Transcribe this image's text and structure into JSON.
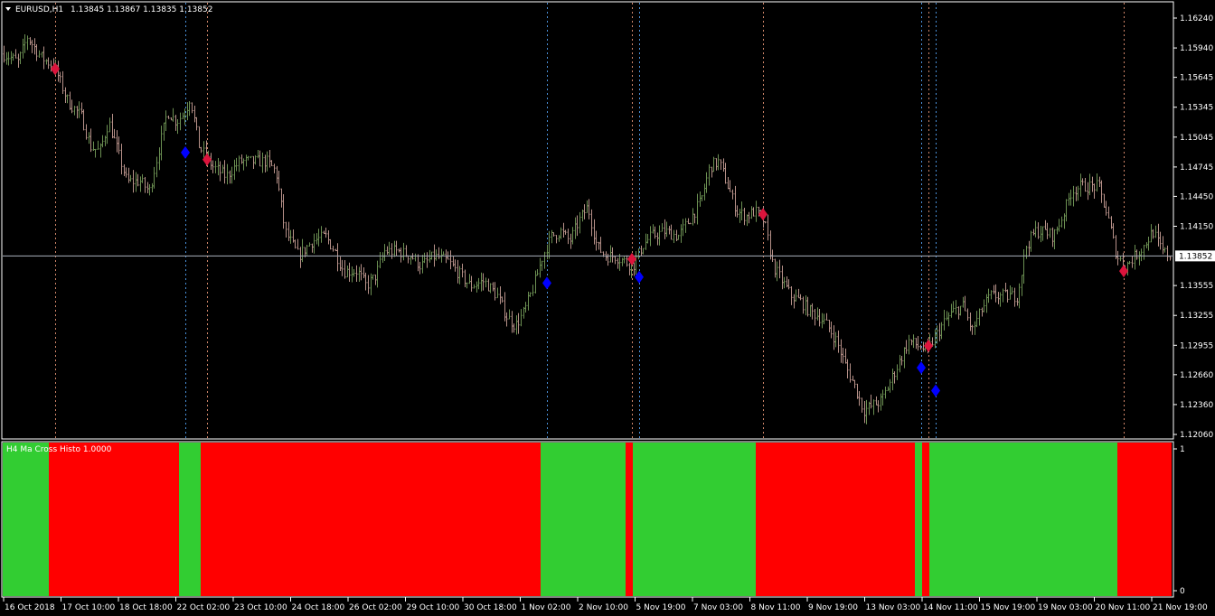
{
  "header": {
    "symbol_tf": "EURUSD,H1",
    "ohlc": "1.13845 1.13867 1.13835 1.13852"
  },
  "indicator": {
    "title": "H4 Ma Cross Histo 1.0000",
    "axis_ticks": [
      "1",
      "0"
    ]
  },
  "colors": {
    "background": "#000000",
    "bull_bar": "#6b8f52",
    "bear_bar": "#b79189",
    "axis": "#ffffff",
    "sell_marker": "#dc143c",
    "buy_marker": "#0000ff",
    "sell_vline": "#d2876a",
    "buy_vline": "#4a90d9",
    "histo_green": "#32cd32",
    "histo_red": "#ff0000",
    "price_line": "#a9b1bd"
  },
  "icons": {
    "dropdown": "triangle-down-icon",
    "sell_signal": "red-diamond-icon",
    "buy_signal": "blue-diamond-icon"
  },
  "chart_data": {
    "type": "ohlc",
    "price_axis": {
      "ticks": [
        "1.16240",
        "1.15940",
        "1.15645",
        "1.15345",
        "1.15045",
        "1.14745",
        "1.14450",
        "1.14150",
        "1.13555",
        "1.13255",
        "1.12955",
        "1.12660",
        "1.12360",
        "1.12060"
      ],
      "ylim": [
        1.1206,
        1.1624
      ],
      "current_price": "1.13852"
    },
    "time_axis": {
      "ticks": [
        "16 Oct 2018",
        "17 Oct 10:00",
        "18 Oct 18:00",
        "22 Oct 02:00",
        "23 Oct 10:00",
        "24 Oct 18:00",
        "26 Oct 02:00",
        "29 Oct 10:00",
        "30 Oct 18:00",
        "1 Nov 02:00",
        "2 Nov 10:00",
        "5 Nov 19:00",
        "7 Nov 03:00",
        "8 Nov 11:00",
        "9 Nov 19:00",
        "13 Nov 03:00",
        "14 Nov 11:00",
        "15 Nov 19:00",
        "19 Nov 03:00",
        "20 Nov 11:00",
        "21 Nov 19:00"
      ]
    },
    "close_path": [
      [
        0,
        1.159
      ],
      [
        20,
        1.158
      ],
      [
        30,
        1.1605
      ],
      [
        45,
        1.1585
      ],
      [
        60,
        1.1575
      ],
      [
        75,
        1.154
      ],
      [
        90,
        1.1525
      ],
      [
        100,
        1.1495
      ],
      [
        110,
        1.149
      ],
      [
        120,
        1.152
      ],
      [
        130,
        1.149
      ],
      [
        140,
        1.146
      ],
      [
        155,
        1.146
      ],
      [
        165,
        1.145
      ],
      [
        175,
        1.149
      ],
      [
        185,
        1.153
      ],
      [
        195,
        1.152
      ],
      [
        205,
        1.153
      ],
      [
        210,
        1.1545
      ],
      [
        220,
        1.1495
      ],
      [
        235,
        1.1475
      ],
      [
        250,
        1.1465
      ],
      [
        265,
        1.148
      ],
      [
        280,
        1.148
      ],
      [
        295,
        1.148
      ],
      [
        305,
        1.147
      ],
      [
        315,
        1.141
      ],
      [
        330,
        1.1385
      ],
      [
        345,
        1.14
      ],
      [
        360,
        1.1405
      ],
      [
        370,
        1.139
      ],
      [
        380,
        1.137
      ],
      [
        395,
        1.137
      ],
      [
        405,
        1.1355
      ],
      [
        415,
        1.1365
      ],
      [
        425,
        1.139
      ],
      [
        440,
        1.139
      ],
      [
        455,
        1.1385
      ],
      [
        465,
        1.1375
      ],
      [
        480,
        1.1385
      ],
      [
        495,
        1.138
      ],
      [
        510,
        1.1365
      ],
      [
        520,
        1.1355
      ],
      [
        535,
        1.136
      ],
      [
        550,
        1.1345
      ],
      [
        560,
        1.1325
      ],
      [
        570,
        1.1315
      ],
      [
        580,
        1.133
      ],
      [
        590,
        1.1355
      ],
      [
        600,
        1.1385
      ],
      [
        610,
        1.1405
      ],
      [
        620,
        1.141
      ],
      [
        630,
        1.14
      ],
      [
        640,
        1.142
      ],
      [
        650,
        1.1435
      ],
      [
        660,
        1.1395
      ],
      [
        670,
        1.1385
      ],
      [
        680,
        1.1385
      ],
      [
        690,
        1.138
      ],
      [
        700,
        1.1375
      ],
      [
        710,
        1.1395
      ],
      [
        720,
        1.1405
      ],
      [
        735,
        1.141
      ],
      [
        750,
        1.1405
      ],
      [
        765,
        1.1425
      ],
      [
        775,
        1.144
      ],
      [
        785,
        1.1475
      ],
      [
        795,
        1.148
      ],
      [
        805,
        1.1455
      ],
      [
        815,
        1.143
      ],
      [
        825,
        1.1425
      ],
      [
        835,
        1.143
      ],
      [
        845,
        1.142
      ],
      [
        855,
        1.1375
      ],
      [
        865,
        1.136
      ],
      [
        875,
        1.1345
      ],
      [
        885,
        1.134
      ],
      [
        895,
        1.133
      ],
      [
        905,
        1.1325
      ],
      [
        915,
        1.1315
      ],
      [
        925,
        1.13
      ],
      [
        935,
        1.1275
      ],
      [
        945,
        1.1255
      ],
      [
        955,
        1.123
      ],
      [
        965,
        1.1235
      ],
      [
        975,
        1.124
      ],
      [
        985,
        1.126
      ],
      [
        995,
        1.128
      ],
      [
        1005,
        1.13
      ],
      [
        1015,
        1.1295
      ],
      [
        1025,
        1.129
      ],
      [
        1035,
        1.1305
      ],
      [
        1045,
        1.132
      ],
      [
        1055,
        1.133
      ],
      [
        1065,
        1.1335
      ],
      [
        1075,
        1.131
      ],
      [
        1085,
        1.133
      ],
      [
        1095,
        1.1345
      ],
      [
        1105,
        1.1345
      ],
      [
        1115,
        1.1345
      ],
      [
        1125,
        1.1345
      ],
      [
        1135,
        1.1395
      ],
      [
        1145,
        1.141
      ],
      [
        1155,
        1.141
      ],
      [
        1165,
        1.1405
      ],
      [
        1175,
        1.1425
      ],
      [
        1185,
        1.145
      ],
      [
        1195,
        1.1455
      ],
      [
        1205,
        1.1455
      ],
      [
        1215,
        1.1455
      ],
      [
        1225,
        1.1425
      ],
      [
        1235,
        1.1385
      ],
      [
        1245,
        1.1375
      ],
      [
        1255,
        1.1385
      ],
      [
        1265,
        1.1395
      ],
      [
        1275,
        1.141
      ],
      [
        1285,
        1.139
      ],
      [
        1295,
        1.1385
      ]
    ],
    "signals": [
      {
        "type": "sell",
        "x": 61,
        "price": 1.1573
      },
      {
        "type": "buy",
        "x": 205,
        "price": 1.1489
      },
      {
        "type": "sell",
        "x": 229,
        "price": 1.1482
      },
      {
        "type": "buy",
        "x": 605,
        "price": 1.1358
      },
      {
        "type": "sell",
        "x": 699,
        "price": 1.1382
      },
      {
        "type": "buy",
        "x": 707,
        "price": 1.1364
      },
      {
        "type": "sell",
        "x": 844,
        "price": 1.1427
      },
      {
        "type": "buy",
        "x": 1019,
        "price": 1.1273
      },
      {
        "type": "sell",
        "x": 1027,
        "price": 1.1295
      },
      {
        "type": "buy",
        "x": 1035,
        "price": 1.125
      },
      {
        "type": "sell",
        "x": 1243,
        "price": 1.137
      }
    ],
    "histogram": [
      {
        "from": 0,
        "to": 54,
        "color": "green"
      },
      {
        "from": 54,
        "to": 198,
        "color": "red"
      },
      {
        "from": 198,
        "to": 222,
        "color": "green"
      },
      {
        "from": 222,
        "to": 598,
        "color": "red"
      },
      {
        "from": 598,
        "to": 692,
        "color": "green"
      },
      {
        "from": 692,
        "to": 700,
        "color": "red"
      },
      {
        "from": 700,
        "to": 836,
        "color": "green"
      },
      {
        "from": 836,
        "to": 1012,
        "color": "red"
      },
      {
        "from": 1012,
        "to": 1020,
        "color": "green"
      },
      {
        "from": 1020,
        "to": 1028,
        "color": "red"
      },
      {
        "from": 1028,
        "to": 1236,
        "color": "green"
      },
      {
        "from": 1236,
        "to": 1296,
        "color": "red"
      }
    ]
  }
}
